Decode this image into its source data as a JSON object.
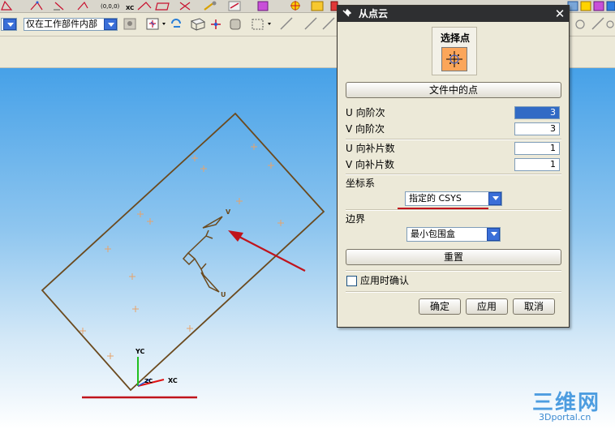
{
  "toolbar": {
    "filter_value": "仅在工作部件内部"
  },
  "toolbar_icon_labels": {
    "origin": "(0,0,0)",
    "xc": "XC"
  },
  "viewport": {
    "axis_labels": {
      "v": "V",
      "u": "U",
      "yc": "YC",
      "xc": "XC",
      "zc": "ZC"
    },
    "rect_color": "#6b4a1e",
    "marker_color": "#e6a36b",
    "annotation_color": "#c0141c"
  },
  "dialog": {
    "title": "从点云",
    "select_points_label": "选择点",
    "points_from_file_button": "文件中的点",
    "u_degree_label": "U 向阶次",
    "u_degree_value": "3",
    "v_degree_label": "V 向阶次",
    "v_degree_value": "3",
    "u_patches_label": "U 向补片数",
    "u_patches_value": "1",
    "v_patches_label": "V 向补片数",
    "v_patches_value": "1",
    "csys_label": "坐标系",
    "csys_value": "指定的 CSYS",
    "boundary_label": "边界",
    "boundary_value": "最小包围盒",
    "reset_button": "重置",
    "confirm_on_apply_label": "应用时确认",
    "ok_button": "确定",
    "apply_button": "应用",
    "cancel_button": "取消"
  },
  "watermark": {
    "big": "三维网",
    "small": "3Dportal.cn"
  }
}
